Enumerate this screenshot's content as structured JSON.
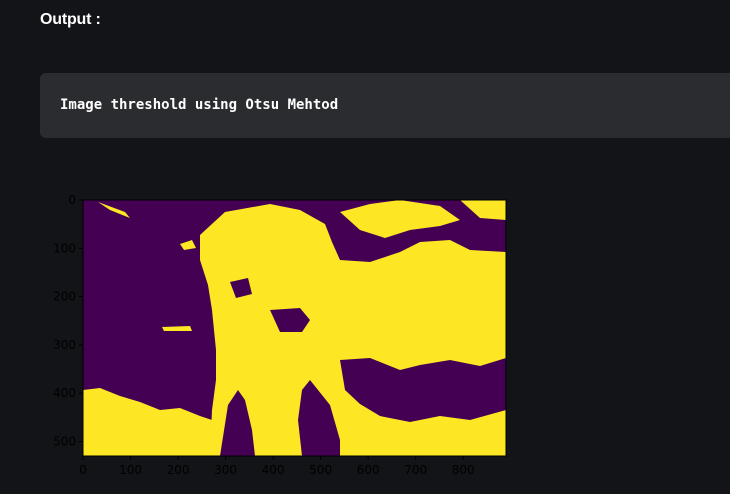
{
  "section": {
    "heading": "Output :"
  },
  "code_block": {
    "text": "Image threshold using Otsu Mehtod"
  },
  "figure": {
    "image_description_colors": {
      "background": "#440154",
      "foreground": "#fde725"
    },
    "x_ticks": [
      "0",
      "100",
      "200",
      "300",
      "400",
      "500",
      "600",
      "700",
      "800"
    ],
    "y_ticks": [
      "0",
      "100",
      "200",
      "300",
      "400",
      "500"
    ],
    "x_range": [
      0,
      890
    ],
    "y_range": [
      0,
      530
    ]
  }
}
